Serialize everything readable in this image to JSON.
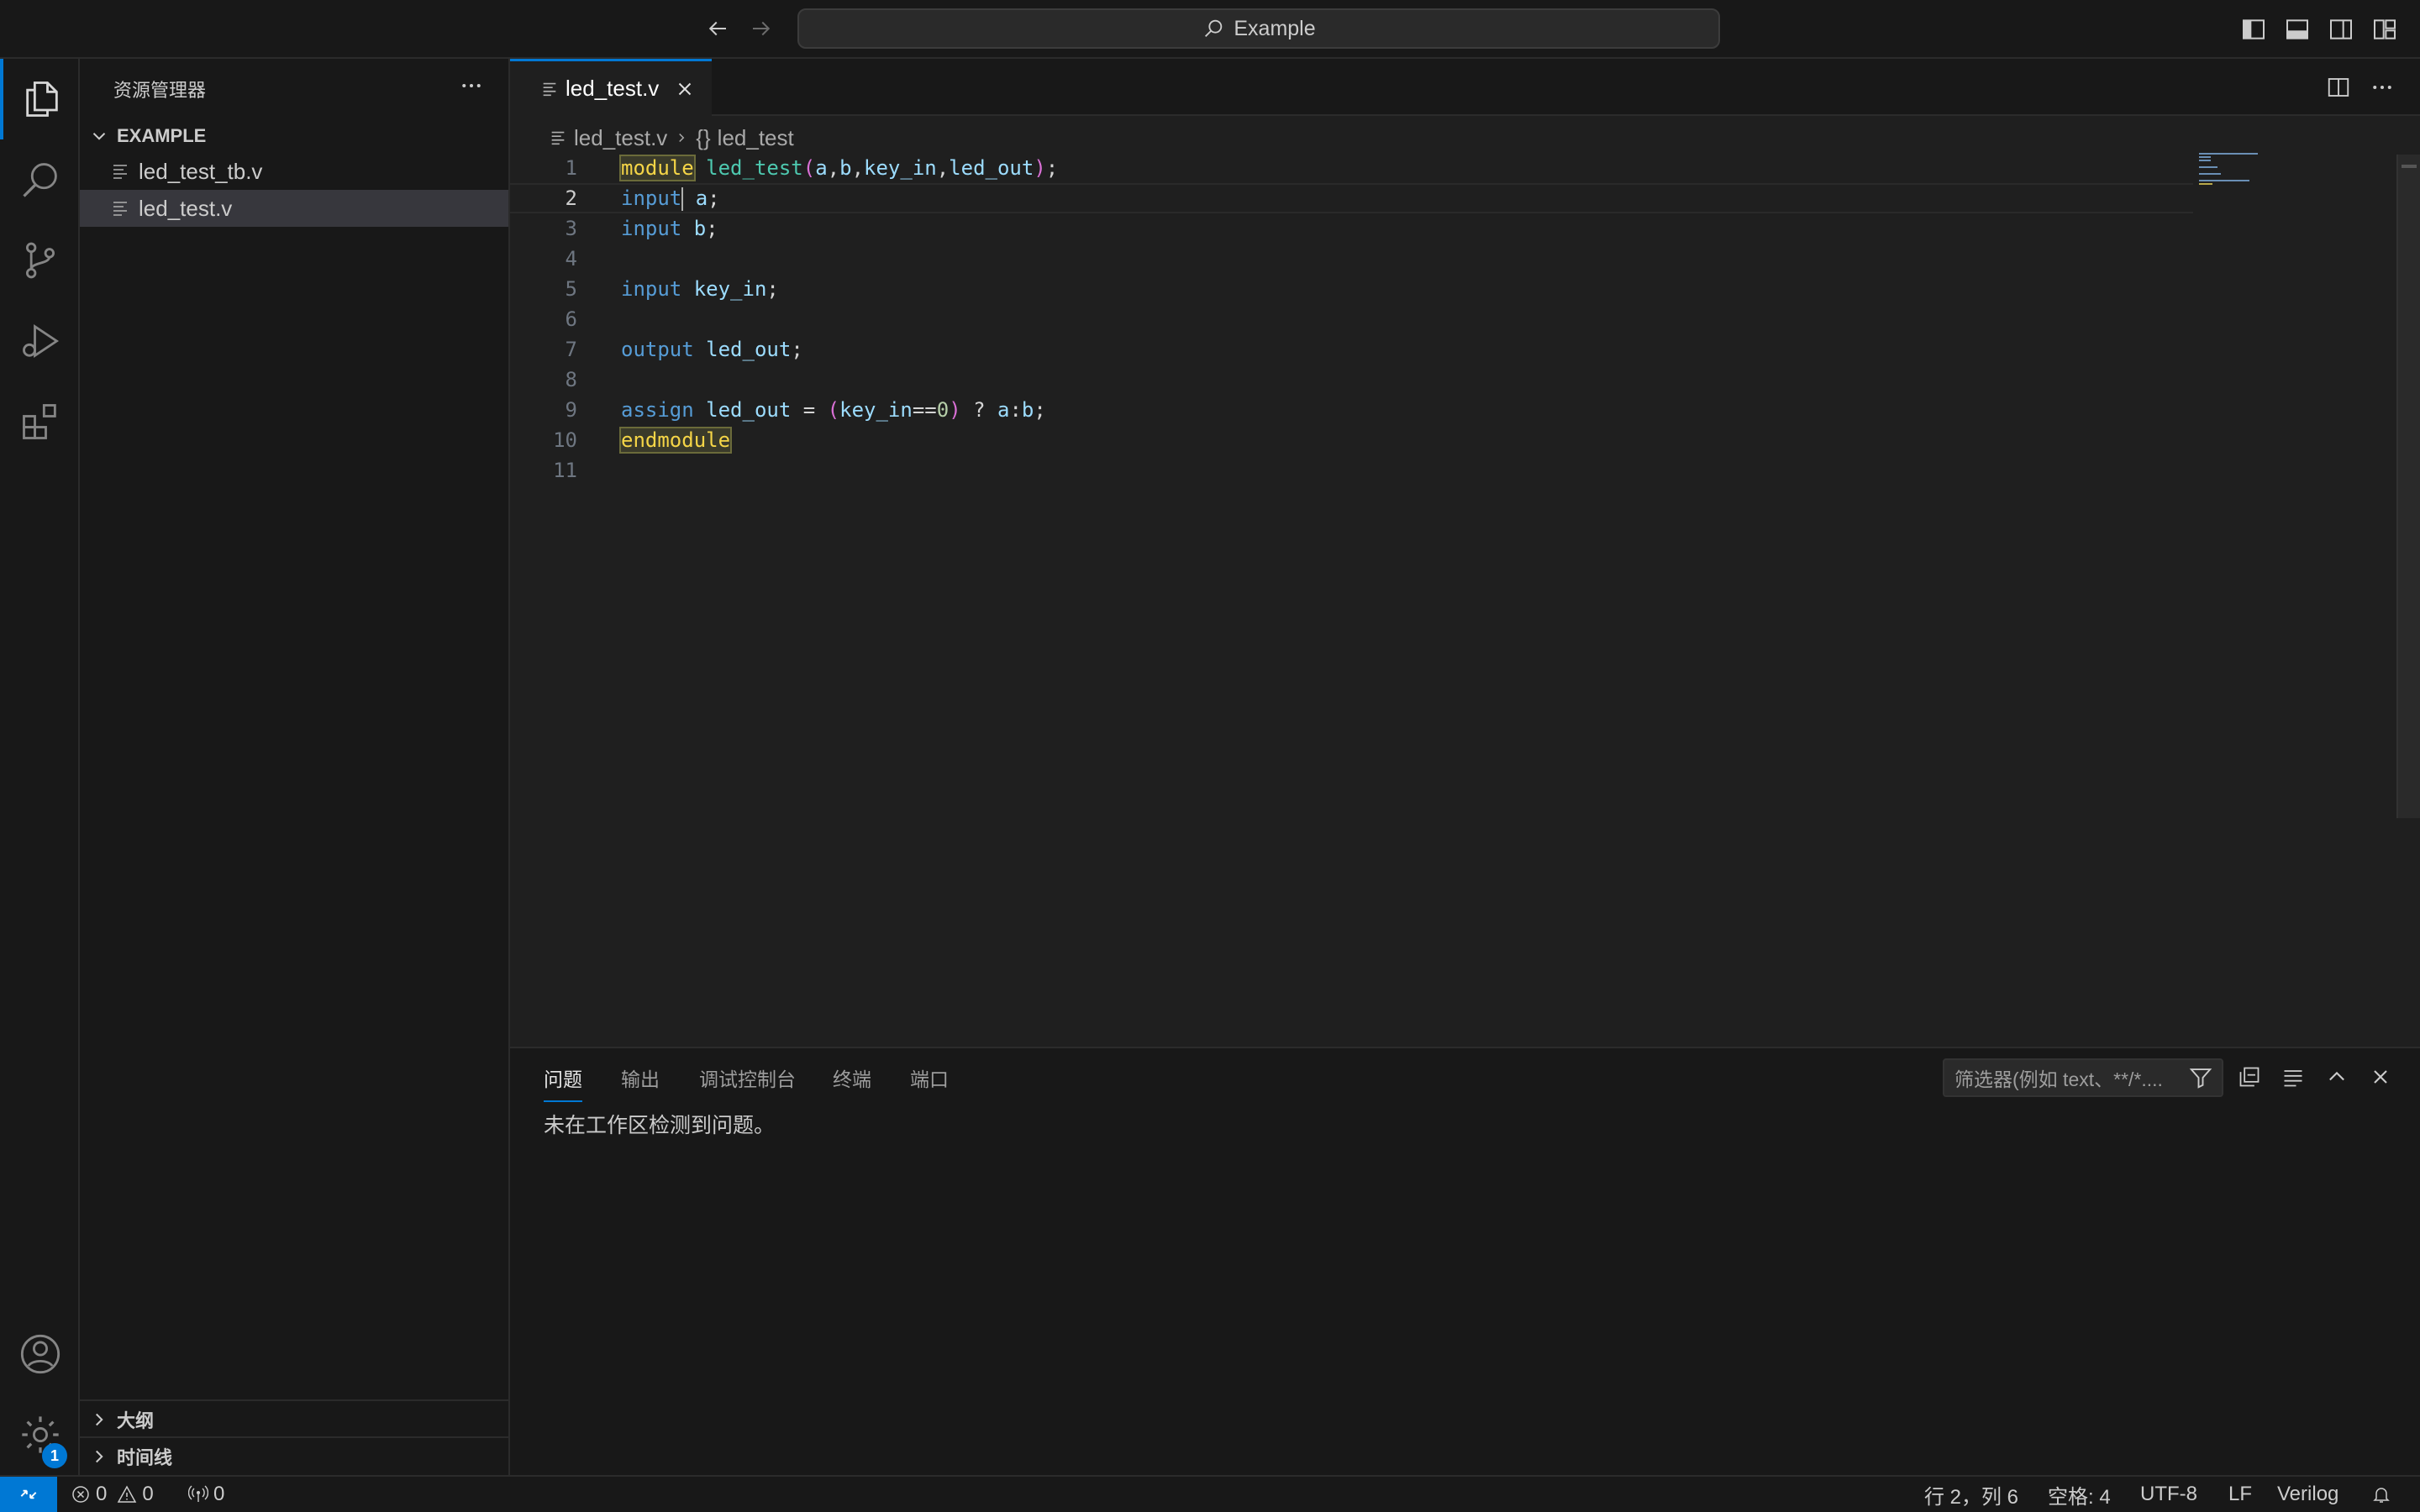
{
  "titlebar": {
    "search_text": "Example"
  },
  "sidebar": {
    "title": "资源管理器",
    "folder": "EXAMPLE",
    "files": [
      "led_test_tb.v",
      "led_test.v"
    ],
    "sections": [
      "大纲",
      "时间线"
    ]
  },
  "editor": {
    "tab_label": "led_test.v",
    "breadcrumb": {
      "file": "led_test.v",
      "symbol": "led_test"
    },
    "line_numbers": [
      "1",
      "2",
      "3",
      "4",
      "5",
      "6",
      "7",
      "8",
      "9",
      "10",
      "11"
    ],
    "lines": [
      "module led_test(a,b,key_in,led_out);",
      "input a;",
      "input b;",
      "",
      "input key_in;",
      "",
      "output led_out;",
      "",
      "assign led_out = (key_in==0) ? a:b;",
      "endmodule",
      ""
    ]
  },
  "panel": {
    "tabs": [
      "问题",
      "输出",
      "调试控制台",
      "终端",
      "端口"
    ],
    "filter_placeholder": "筛选器(例如 text、**/*....",
    "message": "未在工作区检测到问题。"
  },
  "statusbar": {
    "errors": "0",
    "warnings": "0",
    "ports": "0",
    "position": "行 2，列 6",
    "spaces": "空格: 4",
    "encoding": "UTF-8",
    "eol": "LF",
    "language": "Verilog"
  },
  "activity": {
    "settings_badge": "1"
  },
  "colors": {
    "accent": "#0078d4",
    "background": "#1f1f1f",
    "sidebar": "#181818"
  }
}
